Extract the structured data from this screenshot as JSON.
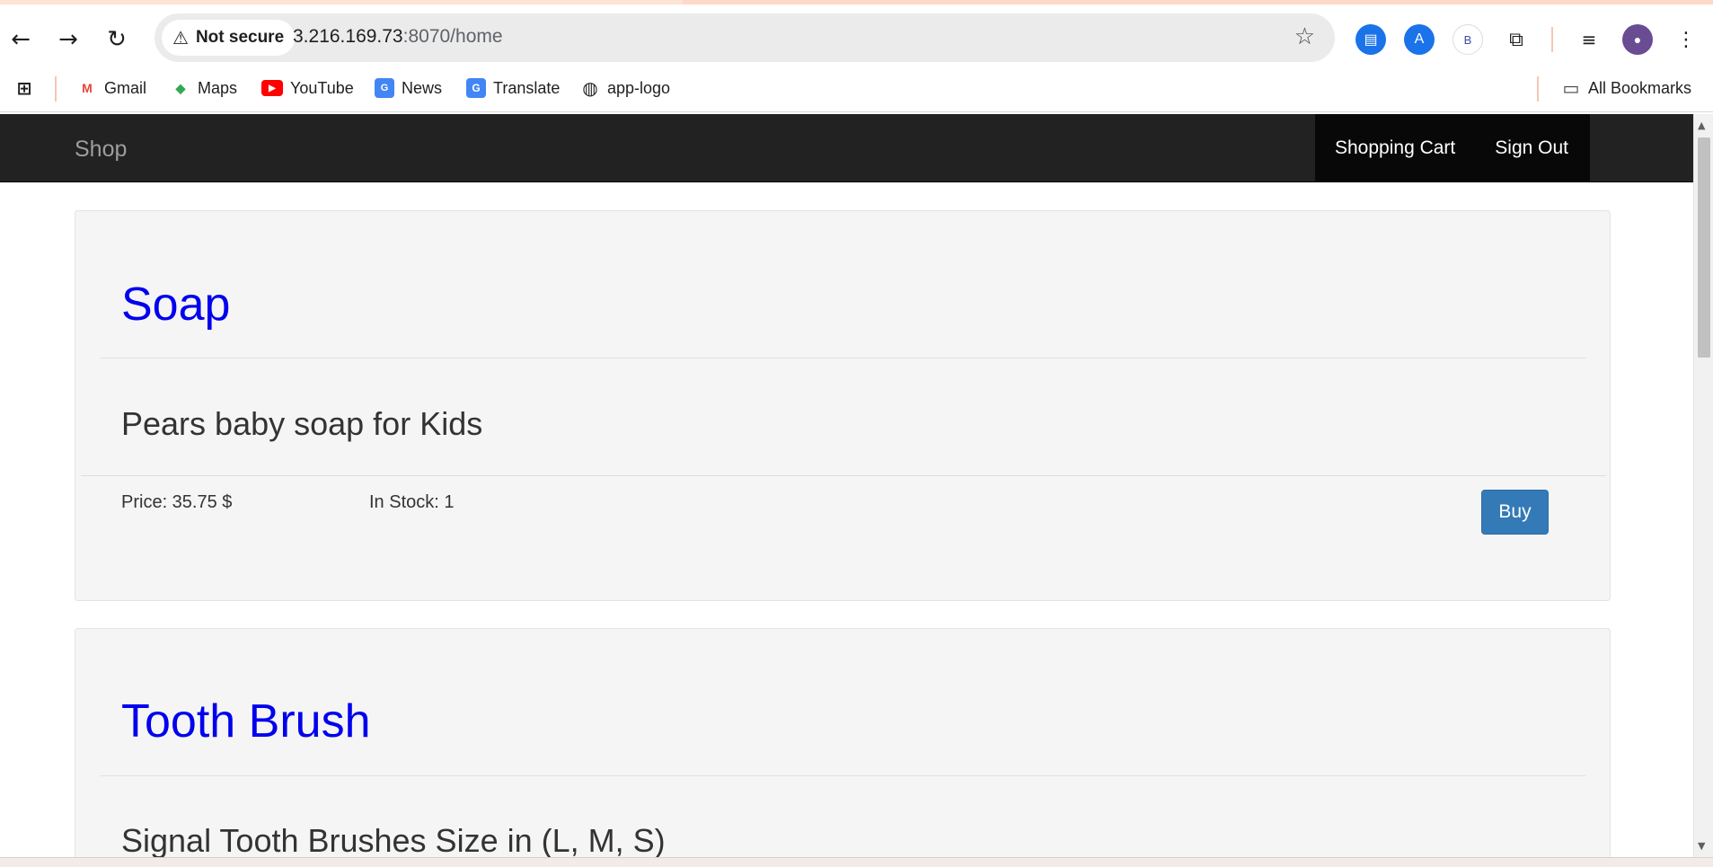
{
  "browser": {
    "security_label": "Not secure",
    "url_host": "3.216.169.73",
    "url_path": ":8070/home",
    "extensions": [
      {
        "name": "docs-extension-icon",
        "glyph": "▤",
        "color": "#1a73e8"
      },
      {
        "name": "app-store-extension-icon",
        "glyph": "A",
        "color": "#1a73e8"
      },
      {
        "name": "b-extension-icon",
        "glyph": "B",
        "color": "#3c4ba6"
      }
    ]
  },
  "bookmarks": [
    {
      "label": "Gmail",
      "icon": "gmail-icon"
    },
    {
      "label": "Maps",
      "icon": "maps-icon"
    },
    {
      "label": "YouTube",
      "icon": "youtube-icon"
    },
    {
      "label": "News",
      "icon": "news-icon"
    },
    {
      "label": "Translate",
      "icon": "translate-icon"
    },
    {
      "label": "app-logo",
      "icon": "globe-icon"
    }
  ],
  "all_bookmarks_label": "All Bookmarks",
  "site": {
    "brand": "Shop",
    "nav": {
      "cart": "Shopping Cart",
      "signout": "Sign Out"
    }
  },
  "products": [
    {
      "title": "Soap",
      "description": "Pears baby soap for Kids",
      "price": "Price: 35.75 $",
      "stock": "In Stock: 1",
      "buy_label": "Buy"
    },
    {
      "title": "Tooth Brush",
      "description": "Signal Tooth Brushes Size in (L, M, S)"
    }
  ],
  "colors": {
    "navbar_bg": "#222222",
    "title_link": "#0000ee",
    "buy_button": "#337ab7",
    "card_bg": "#f5f5f5"
  }
}
